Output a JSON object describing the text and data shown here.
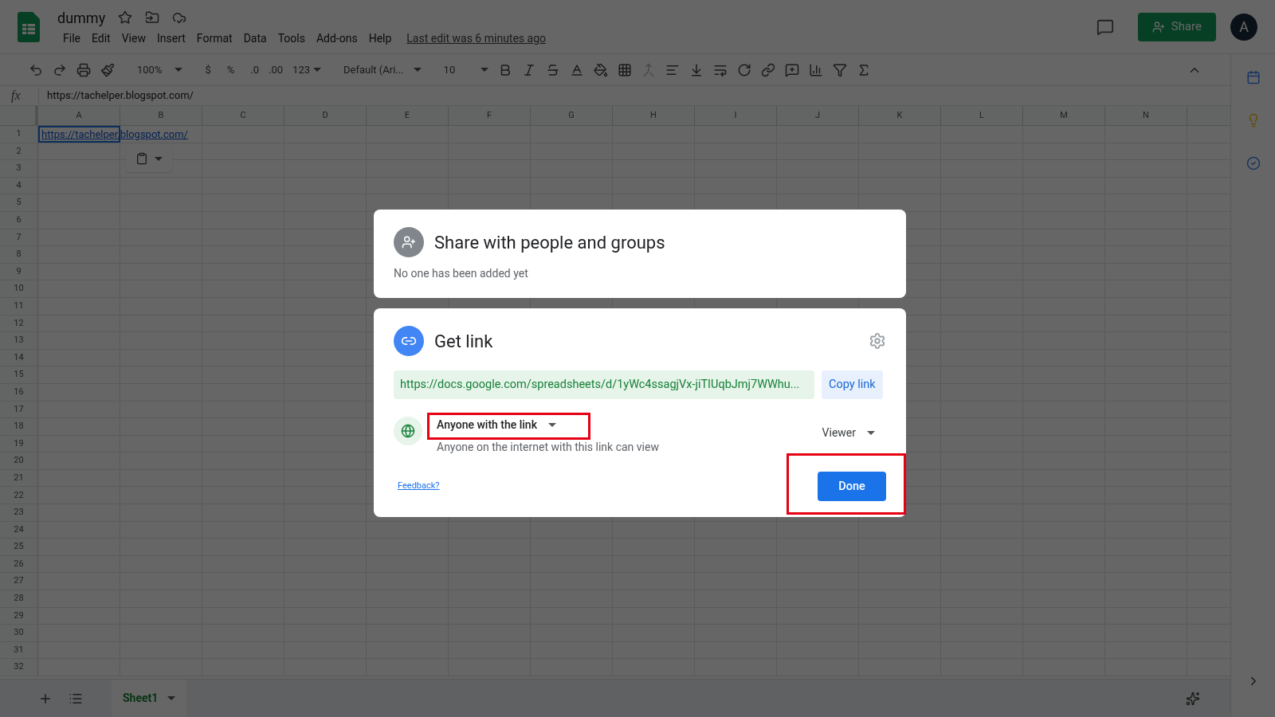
{
  "app": {
    "title": "dummy",
    "menu": [
      "File",
      "Edit",
      "View",
      "Insert",
      "Format",
      "Data",
      "Tools",
      "Add-ons",
      "Help"
    ],
    "last_edit": "Last edit was 6 minutes ago",
    "share_button": "Share",
    "avatar": "A"
  },
  "toolbar": {
    "zoom": "100%",
    "currency": "$",
    "percent": "%",
    "decrease_decimals": ".0",
    "increase_decimals": ".00",
    "more_formats": "123",
    "font": "Default (Ari...",
    "font_size": "10"
  },
  "formula_bar": {
    "label": "fx",
    "value": "https://tachelper.blogspot.com/"
  },
  "grid": {
    "columns": [
      "A",
      "B",
      "C",
      "D",
      "E",
      "F",
      "G",
      "H",
      "I",
      "J",
      "K",
      "L",
      "M",
      "N"
    ],
    "rows": [
      "1",
      "2",
      "3",
      "4",
      "5",
      "6",
      "7",
      "8",
      "9",
      "10",
      "11",
      "12",
      "13",
      "14",
      "15",
      "16",
      "17",
      "18",
      "19",
      "20",
      "21",
      "22",
      "23",
      "24",
      "25",
      "26",
      "27",
      "28",
      "29",
      "30",
      "31",
      "32"
    ],
    "cell_a1": "https://tachelper.blogspot.com/"
  },
  "sheet_tabs": [
    {
      "label": "Sheet1",
      "selected": true
    }
  ],
  "share_dialog": {
    "people_title": "Share with people and groups",
    "people_note": "No one has been added yet",
    "link_title": "Get link",
    "link_url": "https://docs.google.com/spreadsheets/d/1yWc4ssagjVx-jiTIUqbJmj7WWhu...",
    "copy_link": "Copy link",
    "access": "Anyone with the link",
    "access_note": "Anyone on the internet with this link can view",
    "role": "Viewer",
    "feedback": "Feedback?",
    "done": "Done"
  }
}
